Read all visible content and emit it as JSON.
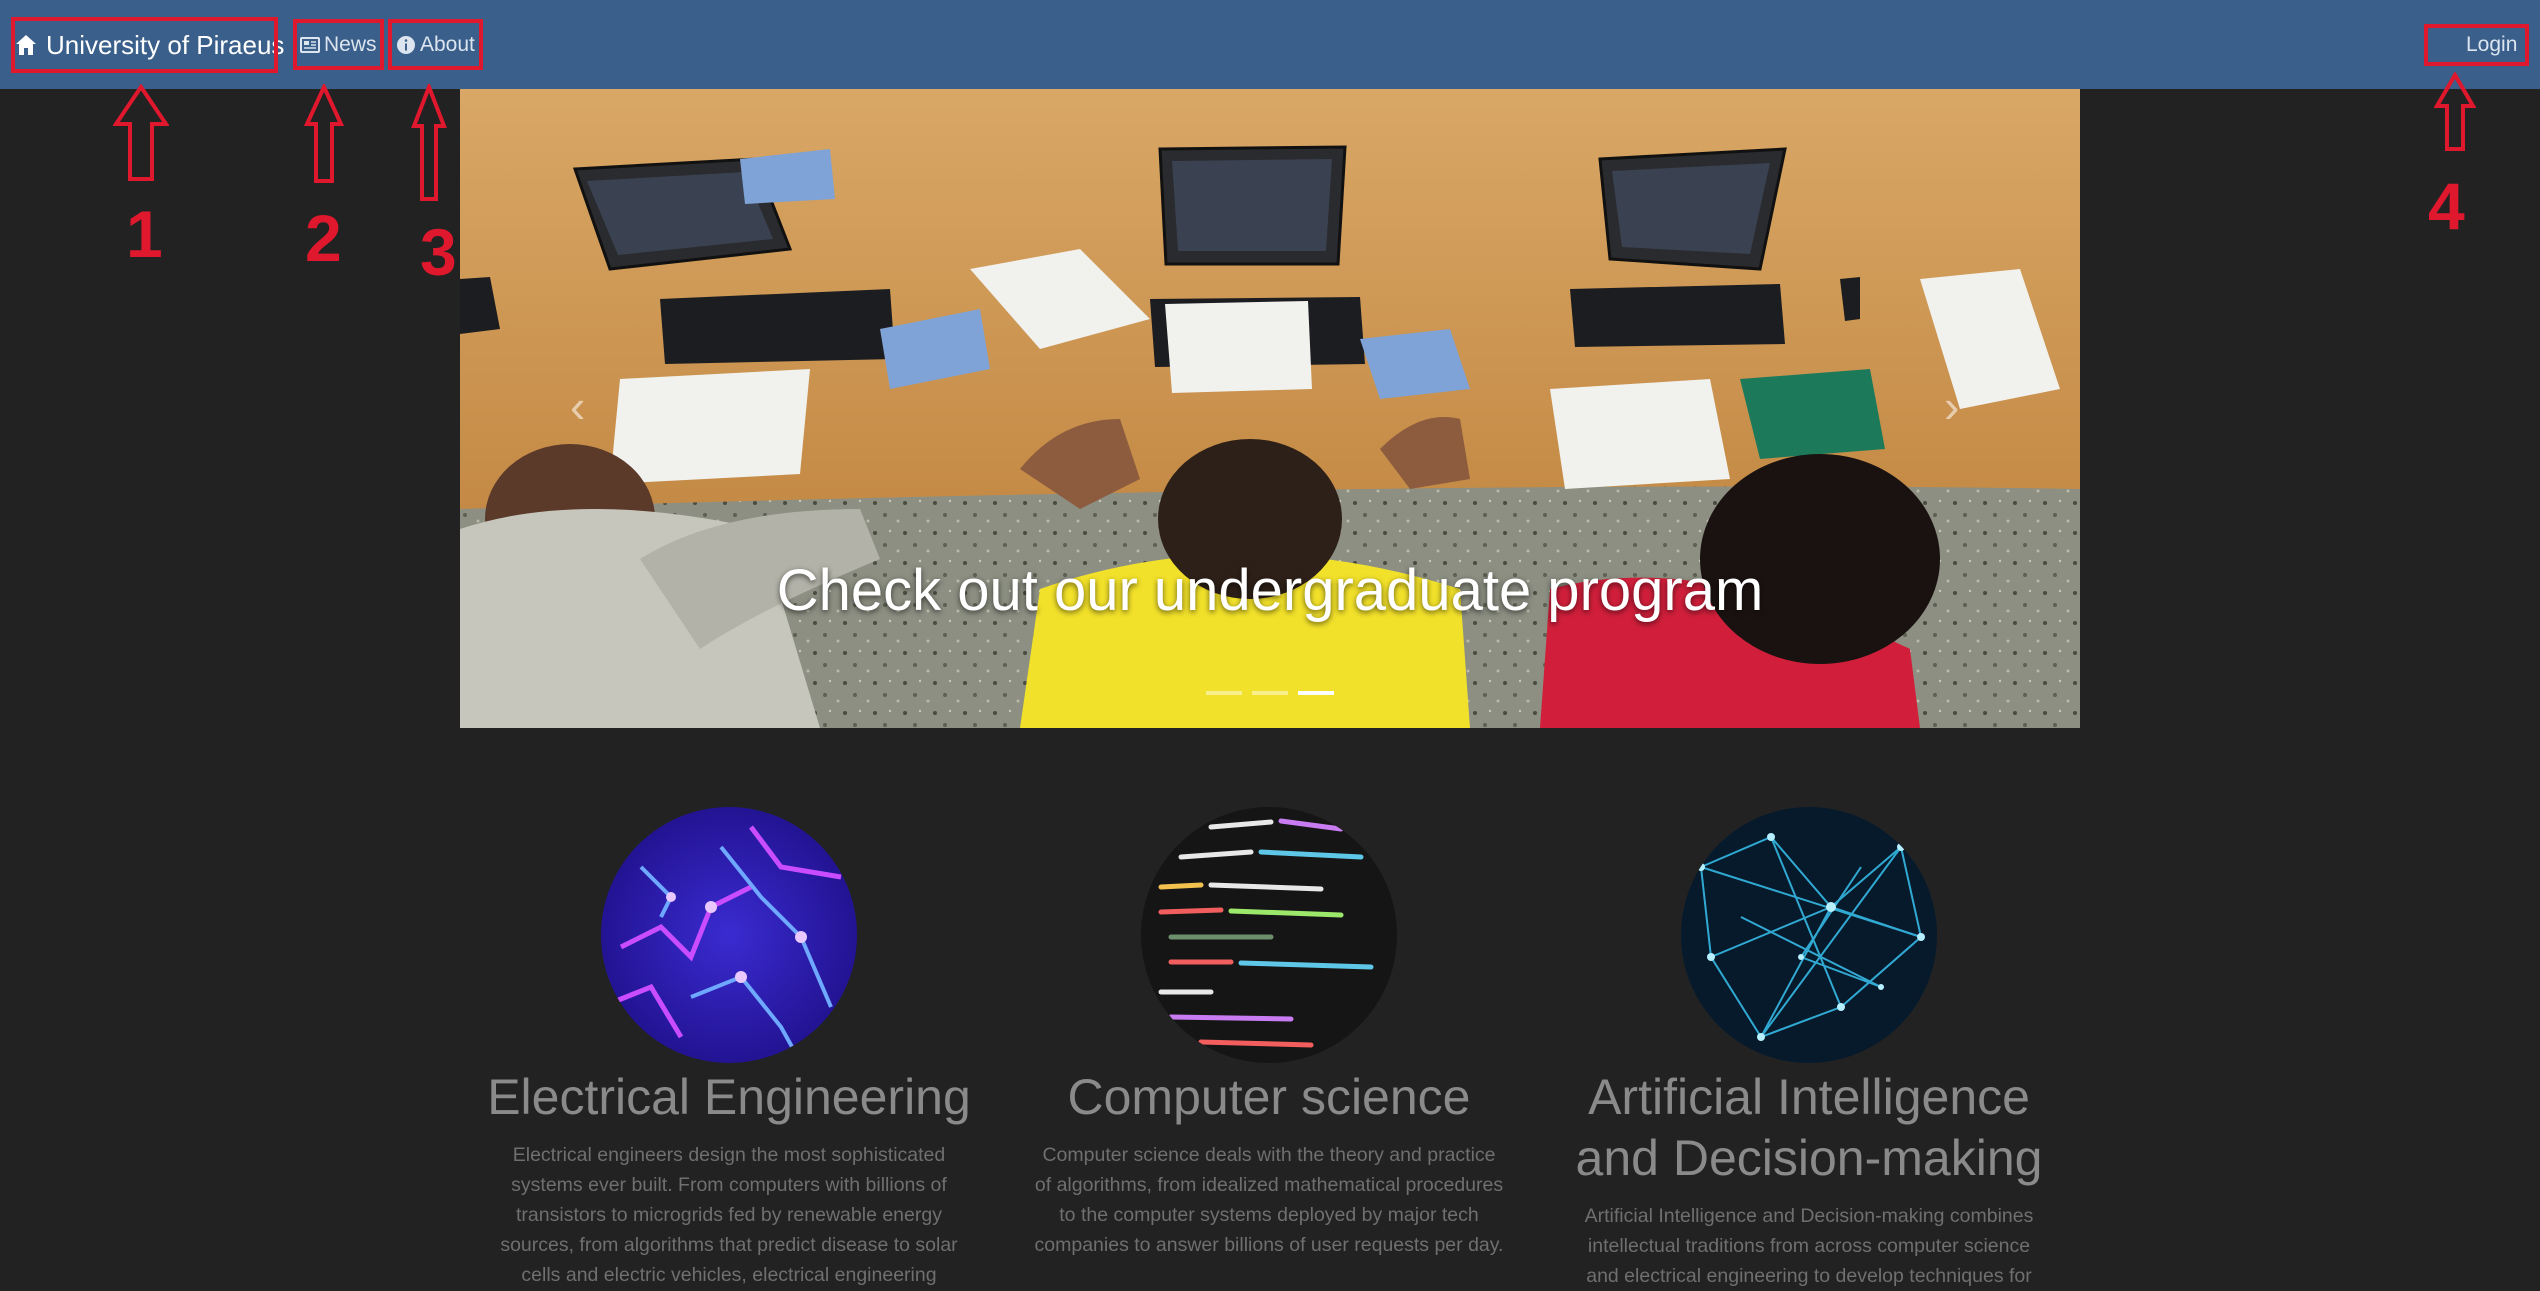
{
  "navbar": {
    "brand": "University of Piraeus",
    "news": "News",
    "about": "About",
    "login": "Login",
    "bg_color": "#3a5f8a"
  },
  "annotations": [
    "1",
    "2",
    "3",
    "4"
  ],
  "carousel": {
    "caption": "Check out our undergraduate program",
    "prev_icon": "‹",
    "next_icon": "›",
    "slide_count": 3,
    "active_index": 2
  },
  "features": [
    {
      "title": "Electrical Engineering",
      "text": "Electrical engineers design the most sophisticated systems ever built. From computers with billions of transistors to microgrids fed by renewable energy sources, from algorithms that predict disease to solar cells and electric vehicles, electrical engineering"
    },
    {
      "title": "Computer science",
      "text": "Computer science deals with the theory and practice of algorithms, from idealized mathematical procedures to the computer systems deployed by major tech companies to answer billions of user requests per day."
    },
    {
      "title": "Artificial Intelligence and Decision-making",
      "text": "Artificial Intelligence and Decision-making combines intellectual traditions from across computer science and electrical engineering to develop techniques for"
    }
  ],
  "colors": {
    "page_bg": "#222222",
    "annotation_red": "#e0182d"
  }
}
